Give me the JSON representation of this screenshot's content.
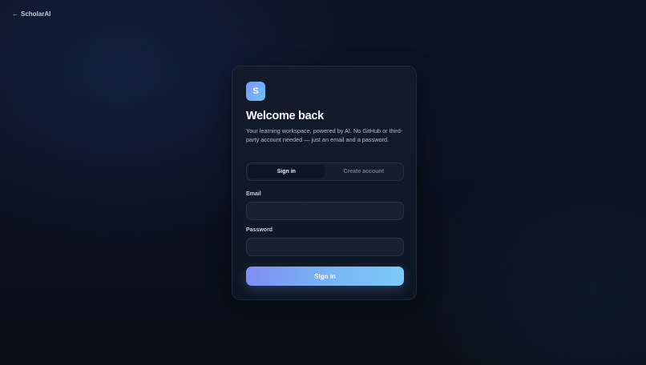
{
  "header": {
    "back_arrow": "←",
    "back_label": "ScholarAI"
  },
  "card": {
    "logo_letter": "S",
    "title": "Welcome back",
    "subtitle": "Your learning workspace, powered by AI. No GitHub or third-party account needed — just an email and a password.",
    "tabs": [
      {
        "label": "Sign in",
        "active": true
      },
      {
        "label": "Create account",
        "active": false
      }
    ],
    "email_label": "Email",
    "email_value": "",
    "password_label": "Password",
    "password_value": "",
    "submit_label": "Sign in"
  },
  "colors": {
    "background": "#0a111e",
    "card": "#111a28",
    "accent_start": "#7f8ff5",
    "accent_end": "#7ccaf7"
  }
}
